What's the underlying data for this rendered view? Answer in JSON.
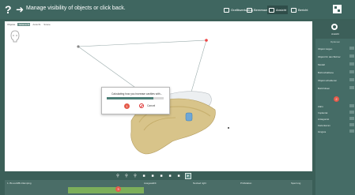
{
  "header": {
    "help_label": "?",
    "title": "Manage visibility of objects or click back.",
    "tools": [
      {
        "label": "Grafikwerkzeug",
        "active": false
      },
      {
        "label": "Bemessen",
        "active": false
      },
      {
        "label": "Ansicht",
        "active": true
      },
      {
        "label": "Bericht",
        "active": false
      }
    ]
  },
  "viewport": {
    "tabs": [
      "Objekte",
      "Teilansicht",
      "Ansicht",
      "Szene"
    ],
    "active_tab": "Teilansicht"
  },
  "dialog": {
    "message": "Calculating how you increase cavities with...",
    "progress": 0.82,
    "badge": "1",
    "cancel_label": "Cancel"
  },
  "toolbar": {
    "icons": [
      "zoom-in-icon",
      "zoom-out-icon",
      "zoom-fit-icon",
      "view-front-icon",
      "view-left-icon",
      "view-right-icon",
      "view-top-icon",
      "view-bottom-icon",
      "select-icon"
    ]
  },
  "bottom": {
    "headings": [
      "1. Bi-Lock/Bi-Clamping",
      "Ausgewählt",
      "Nocked right",
      "Prüfstation",
      "Sperrung"
    ],
    "badge": "3"
  },
  "right_panel": {
    "header_label": "Ansicht",
    "sub_label": "Optionen",
    "rows": [
      "Objekt zeigen",
      "Objekt für den Bohrer",
      "Modell",
      "Bohrschablone",
      "Objekt schattieren",
      "Bohrhülsen",
      "Zahn",
      "Implantat",
      "Antagonist",
      "Kieferkamm",
      "Gingiva"
    ],
    "badge": "2"
  },
  "colors": {
    "accent": "#3f6660",
    "badge": "#e55a4a",
    "progress_fill": "#4c7f77",
    "bottom_bar": "#7cae5a"
  }
}
